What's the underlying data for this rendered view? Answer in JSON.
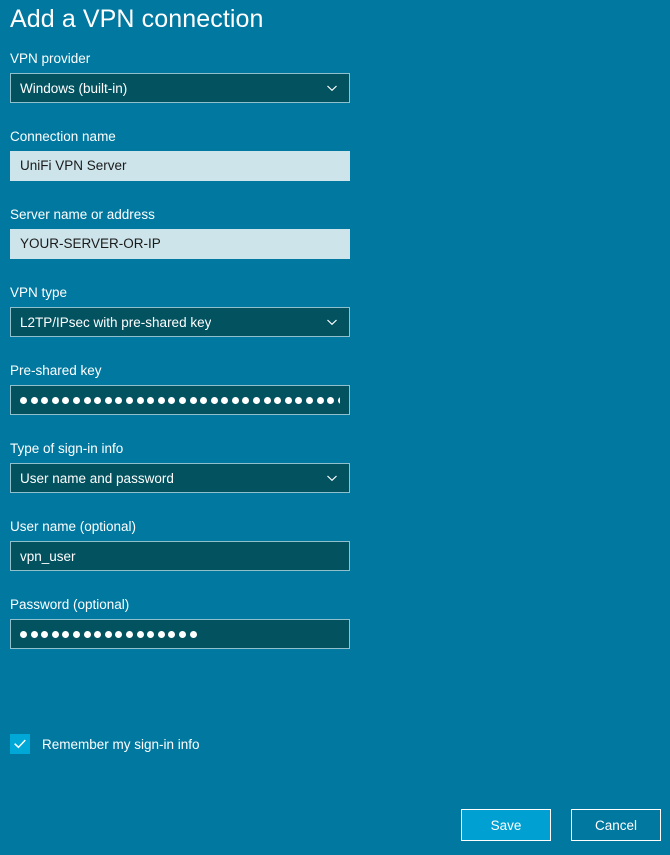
{
  "window": {
    "title": "Add a VPN connection",
    "background_color": "#0078a0",
    "accent_color": "#00a8d8"
  },
  "form": {
    "vpn_provider": {
      "label": "VPN provider",
      "value": "Windows (built-in)",
      "control": "dropdown",
      "icon": "chevron-down-icon"
    },
    "connection_name": {
      "label": "Connection name",
      "value": "UniFi VPN Server",
      "control": "textbox"
    },
    "server_address": {
      "label": "Server name or address",
      "value": "YOUR-SERVER-OR-IP",
      "control": "textbox"
    },
    "vpn_type": {
      "label": "VPN type",
      "value": "L2TP/IPsec with pre-shared key",
      "control": "dropdown",
      "icon": "chevron-down-icon"
    },
    "pre_shared_key": {
      "label": "Pre-shared key",
      "masked": true,
      "mask_character_count": 35,
      "control": "password"
    },
    "sign_in_type": {
      "label": "Type of sign-in info",
      "value": "User name and password",
      "control": "dropdown",
      "icon": "chevron-down-icon"
    },
    "user_name": {
      "label": "User name (optional)",
      "value": "vpn_user",
      "control": "textbox"
    },
    "password": {
      "label": "Password (optional)",
      "masked": true,
      "mask_character_count": 17,
      "control": "password"
    },
    "remember_signin": {
      "label": "Remember my sign-in info",
      "checked": true,
      "icon": "checkmark-icon"
    }
  },
  "actions": {
    "save_label": "Save",
    "cancel_label": "Cancel"
  }
}
